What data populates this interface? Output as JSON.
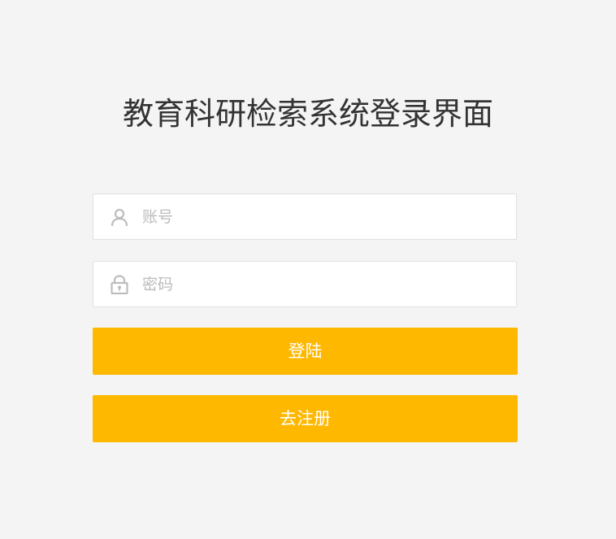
{
  "page": {
    "title": "教育科研检索系统登录界面"
  },
  "form": {
    "username": {
      "placeholder": "账号",
      "value": "",
      "icon": "user-icon"
    },
    "password": {
      "placeholder": "密码",
      "value": "",
      "icon": "lock-icon"
    },
    "login_label": "登陆",
    "register_label": "去注册"
  },
  "colors": {
    "background": "#f4f4f4",
    "button": "#ffb800",
    "button_text": "#ffffff",
    "placeholder": "#bbbbbb",
    "title": "#333333"
  }
}
